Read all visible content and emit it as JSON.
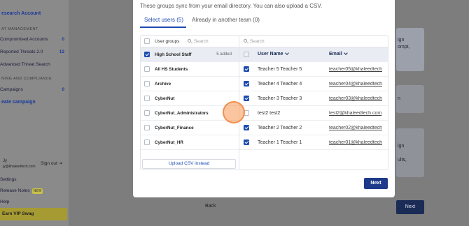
{
  "sidebar": {
    "create_account": "esearch Account",
    "threat_management": "AT MANAGEMENT",
    "compromised_accounts": {
      "label": "Compromised Accounts",
      "count": "0"
    },
    "reported_threats": {
      "label": "Reported Threats 2.0",
      "count": "12"
    },
    "advanced_threat_search": "Advanced Threat Search",
    "training_compliance": "NING AND COMPLIANCE",
    "campaigns": {
      "label": "Campaigns",
      "count": "0"
    },
    "create_campaign": "eate campaign",
    "user_initials": "Jy",
    "user_email": "jy@khaleedtech.com",
    "sign_out": "Sign out",
    "settings": "Settings",
    "release_notes": "Release Notes",
    "new_badge": "NEW",
    "help": "Help",
    "swag": "Earn VIP Swag"
  },
  "background": {
    "right_text_1": "ign",
    "right_text_2": "ompt,",
    "right_text_3": "n",
    "right_text_4": "ign",
    "right_text_5": "ults,",
    "back": "Back",
    "next": "Next"
  },
  "modal": {
    "subtitle": "These groups sync from your email directory. You can also upload a CSV.",
    "tabs": {
      "selected": "Select users (5)",
      "other": "Already in another team (0)"
    },
    "left": {
      "header_label": "User groups",
      "search_placeholder": "Search",
      "groups": [
        {
          "name": "High School Staff",
          "added": "5 added"
        },
        {
          "name": "All HS Students"
        },
        {
          "name": "Archive"
        },
        {
          "name": "CyberNut"
        },
        {
          "name": "CyberNut_Administrators"
        },
        {
          "name": "CyberNut_Finance"
        },
        {
          "name": "CyberNut_HR"
        }
      ],
      "upload_csv": "Upload CSV instead"
    },
    "right": {
      "search_placeholder": "Search",
      "col_username": "User Name",
      "col_email": "Email",
      "users": [
        {
          "name": "Teacher 5 Teacher 5",
          "email": "teacher05@khaleedtech.com",
          "checked": true
        },
        {
          "name": "Teacher 4 Teacher 4",
          "email": "teacher04@khaleedtech.com",
          "checked": true
        },
        {
          "name": "Teacher 3 Teacher 3",
          "email": "teacher03@khaleedtech.com",
          "checked": true
        },
        {
          "name": "test2 test2",
          "email": "test2@khaleedtech.com",
          "checked": false
        },
        {
          "name": "Teacher 2 Teacher 2",
          "email": "teacher02@khaleedtech.com",
          "checked": true
        },
        {
          "name": "Teacher 1 Teacher 1",
          "email": "teacher01@khaleedtech.com",
          "checked": true
        }
      ]
    },
    "next": "Next"
  }
}
